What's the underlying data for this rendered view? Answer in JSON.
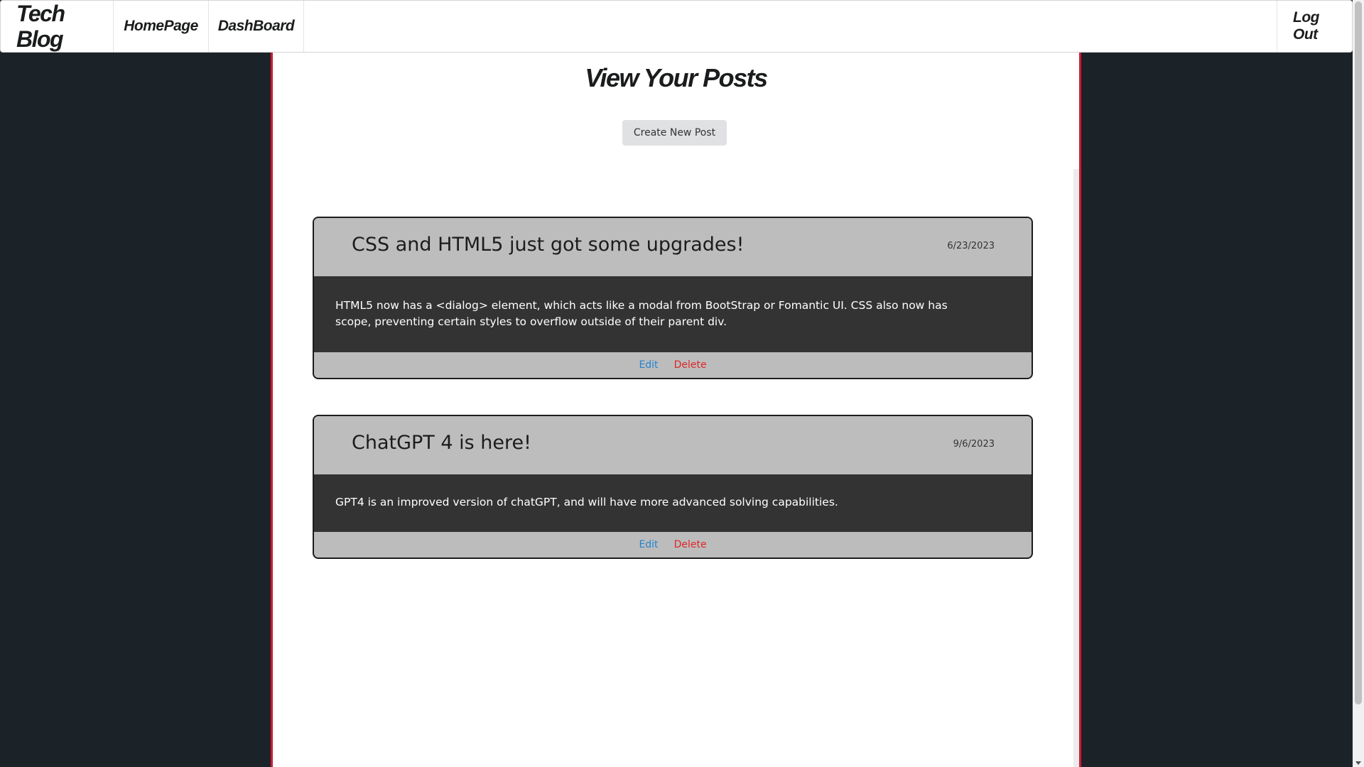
{
  "navbar": {
    "brand": "Tech Blog",
    "links": [
      "HomePage",
      "DashBoard"
    ],
    "logout": "Log Out"
  },
  "page": {
    "title": "View Your Posts",
    "create_button": "Create New Post"
  },
  "posts": [
    {
      "title": "CSS and HTML5 just got some upgrades!",
      "date": "6/23/2023",
      "body": "HTML5 now has a <dialog> element, which acts like a modal from BootStrap or Fomantic UI. CSS also now has scope, preventing certain styles to overflow outside of their parent div.",
      "edit_label": "Edit",
      "delete_label": "Delete"
    },
    {
      "title": "ChatGPT 4 is here!",
      "date": "9/6/2023",
      "body": "GPT4 is an improved version of chatGPT, and will have more advanced solving capabilities.",
      "edit_label": "Edit",
      "delete_label": "Delete"
    }
  ],
  "colors": {
    "background": "#1b2329",
    "accent_red": "#d01a33",
    "edit_blue": "#2185d0",
    "delete_red": "#db2828",
    "post_body": "#333333",
    "post_header": "#bebdbe"
  }
}
